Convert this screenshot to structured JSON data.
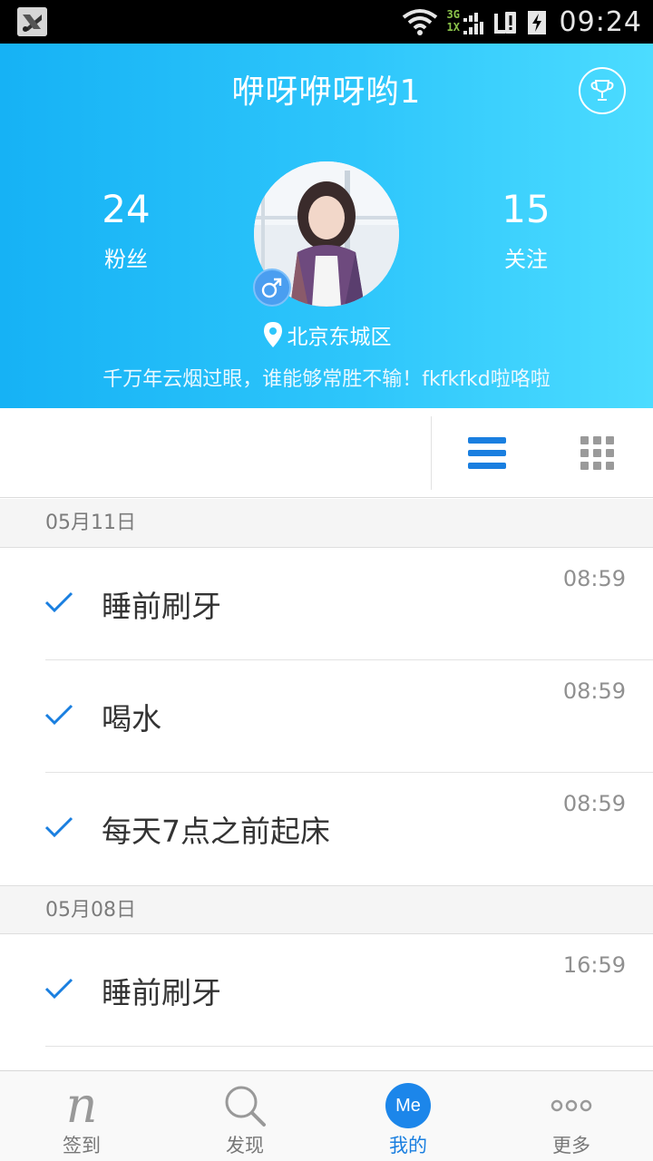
{
  "status_bar": {
    "network_top": "3G",
    "network_bottom": "1X",
    "time": "09:24",
    "icons": [
      "app-notification-icon",
      "wifi-icon",
      "signal-icon",
      "sim-alert-icon",
      "battery-charging-icon"
    ]
  },
  "profile": {
    "name": "咿呀咿呀哟1",
    "fans_count": "24",
    "fans_label": "粉丝",
    "follow_count": "15",
    "follow_label": "关注",
    "gender_symbol": "♂",
    "location": "北京东城区",
    "signature": "千万年云烟过眼，谁能够常胜不输！fkfkfkd啦咯啦"
  },
  "view_toggle": {
    "active": "list",
    "icons": [
      "list-view-icon",
      "grid-view-icon"
    ]
  },
  "feed": {
    "groups": [
      {
        "date": "05月11日",
        "entries": [
          {
            "title": "睡前刷牙",
            "time": "08:59"
          },
          {
            "title": "喝水",
            "time": "08:59"
          },
          {
            "title": "每天7点之前起床",
            "time": "08:59"
          }
        ]
      },
      {
        "date": "05月08日",
        "entries": [
          {
            "title": "睡前刷牙",
            "time": "16:59"
          }
        ]
      }
    ]
  },
  "bottom_nav": {
    "items": [
      {
        "label": "签到",
        "icon": "checkin-icon"
      },
      {
        "label": "发现",
        "icon": "search-icon"
      },
      {
        "label": "我的",
        "icon": "me-icon",
        "badge": "Me",
        "active": true
      },
      {
        "label": "更多",
        "icon": "more-icon"
      }
    ]
  },
  "colors": {
    "header_gradient_start": "#16b2f5",
    "header_gradient_end": "#4cdcff",
    "accent": "#1c86ea",
    "check": "#1a7fe0"
  }
}
